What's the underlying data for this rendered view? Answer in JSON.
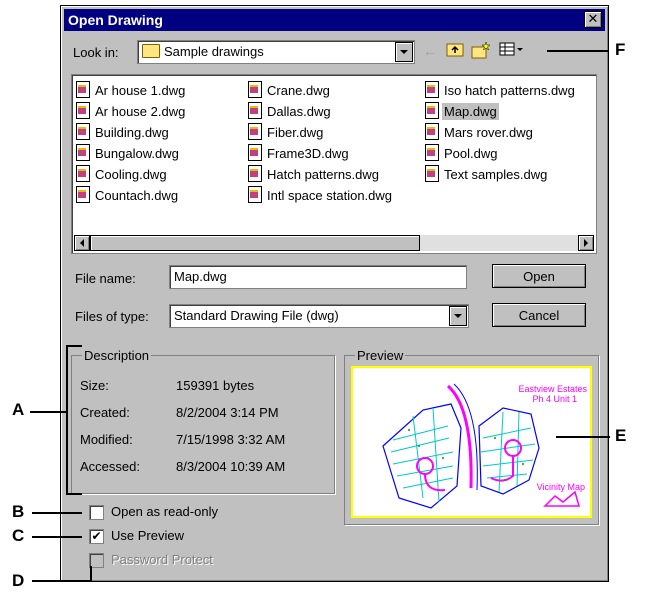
{
  "dialog": {
    "title": "Open Drawing",
    "close_label": "✕"
  },
  "lookin": {
    "label": "Look in:",
    "value": "Sample drawings"
  },
  "files": {
    "col1": [
      "Ar house 1.dwg",
      "Ar house 2.dwg",
      "Building.dwg",
      "Bungalow.dwg",
      "Cooling.dwg",
      "Countach.dwg"
    ],
    "col2": [
      "Crane.dwg",
      "Dallas.dwg",
      "Fiber.dwg",
      "Frame3D.dwg",
      "Hatch patterns.dwg",
      "Intl space station.dwg"
    ],
    "col3": [
      "Iso hatch patterns.dwg",
      "Map.dwg",
      "Mars rover.dwg",
      "Pool.dwg",
      "Text samples.dwg"
    ],
    "selected": "Map.dwg"
  },
  "filename": {
    "label": "File name:",
    "value": "Map.dwg"
  },
  "filetype": {
    "label": "Files of type:",
    "value": "Standard Drawing File (dwg)"
  },
  "buttons": {
    "open": "Open",
    "cancel": "Cancel"
  },
  "description": {
    "title": "Description",
    "size_label": "Size:",
    "size_value": "159391 bytes",
    "created_label": "Created:",
    "created_value": "8/2/2004 3:14 PM",
    "modified_label": "Modified:",
    "modified_value": "7/15/1998 3:32 AM",
    "accessed_label": "Accessed:",
    "accessed_value": "8/3/2004 10:39 AM"
  },
  "preview": {
    "title": "Preview",
    "map_title_line1": "Eastview Estates",
    "map_title_line2": "Ph 4 Unit 1",
    "vicinity_label": "Vicinity Map"
  },
  "options": {
    "readonly": {
      "label": "Open as read-only",
      "checked": false
    },
    "use_preview": {
      "label": "Use Preview",
      "checked": true
    },
    "password": {
      "label": "Password Protect",
      "checked": false,
      "disabled": true
    }
  },
  "callouts": {
    "A": "A",
    "B": "B",
    "C": "C",
    "D": "D",
    "E": "E",
    "F": "F"
  },
  "colors": {
    "titlebar": "#000080",
    "dialog": "#c0c0c0",
    "preview_border": "#ffff00",
    "map_lines": "#00c8c8",
    "map_boundary": "#0000ff",
    "map_label": "#ff00ff"
  }
}
